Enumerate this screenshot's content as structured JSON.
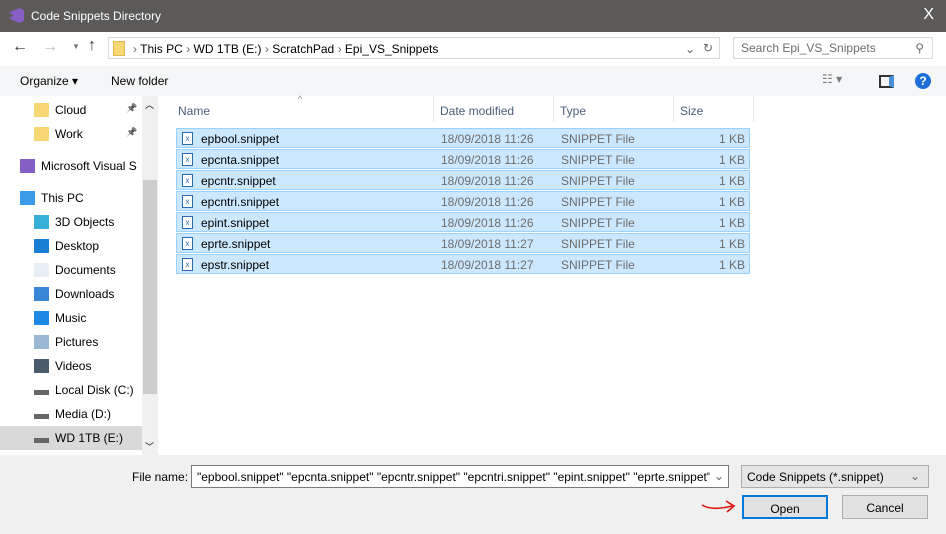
{
  "window": {
    "title": "Code Snippets Directory",
    "close": "X"
  },
  "address": {
    "crumbs": [
      "This PC",
      "WD 1TB (E:)",
      "ScratchPad",
      "Epi_VS_Snippets"
    ],
    "search_placeholder": "Search Epi_VS_Snippets"
  },
  "toolbar": {
    "organize": "Organize ▾",
    "new_folder": "New folder"
  },
  "nav": {
    "items": [
      {
        "label": "Cloud",
        "icon": "folder-icon"
      },
      {
        "label": "Work",
        "icon": "folder-icon"
      },
      {
        "label": "Microsoft Visual S",
        "icon": "visual-studio-icon"
      },
      {
        "label": "This PC",
        "icon": "computer-icon"
      },
      {
        "label": "3D Objects",
        "icon": "3d-objects-icon"
      },
      {
        "label": "Desktop",
        "icon": "desktop-icon"
      },
      {
        "label": "Documents",
        "icon": "documents-icon"
      },
      {
        "label": "Downloads",
        "icon": "downloads-icon"
      },
      {
        "label": "Music",
        "icon": "music-icon"
      },
      {
        "label": "Pictures",
        "icon": "pictures-icon"
      },
      {
        "label": "Videos",
        "icon": "videos-icon"
      },
      {
        "label": "Local Disk (C:)",
        "icon": "drive-icon"
      },
      {
        "label": "Media (D:)",
        "icon": "drive-icon"
      },
      {
        "label": "WD 1TB (E:)",
        "icon": "drive-icon"
      }
    ]
  },
  "columns": [
    "Name",
    "Date modified",
    "Type",
    "Size"
  ],
  "files": [
    {
      "name": "epbool.snippet",
      "date": "18/09/2018 11:26",
      "type": "SNIPPET File",
      "size": "1 KB"
    },
    {
      "name": "epcnta.snippet",
      "date": "18/09/2018 11:26",
      "type": "SNIPPET File",
      "size": "1 KB"
    },
    {
      "name": "epcntr.snippet",
      "date": "18/09/2018 11:26",
      "type": "SNIPPET File",
      "size": "1 KB"
    },
    {
      "name": "epcntri.snippet",
      "date": "18/09/2018 11:26",
      "type": "SNIPPET File",
      "size": "1 KB"
    },
    {
      "name": "epint.snippet",
      "date": "18/09/2018 11:26",
      "type": "SNIPPET File",
      "size": "1 KB"
    },
    {
      "name": "eprte.snippet",
      "date": "18/09/2018 11:27",
      "type": "SNIPPET File",
      "size": "1 KB"
    },
    {
      "name": "epstr.snippet",
      "date": "18/09/2018 11:27",
      "type": "SNIPPET File",
      "size": "1 KB"
    }
  ],
  "footer": {
    "file_name_label": "File name:",
    "file_name_value": "\"epbool.snippet\" \"epcnta.snippet\" \"epcntr.snippet\" \"epcntri.snippet\" \"epint.snippet\" \"eprte.snippet\" \"epstr.snippet\"",
    "filter": "Code Snippets (*.snippet)",
    "open": "Open",
    "cancel": "Cancel"
  }
}
